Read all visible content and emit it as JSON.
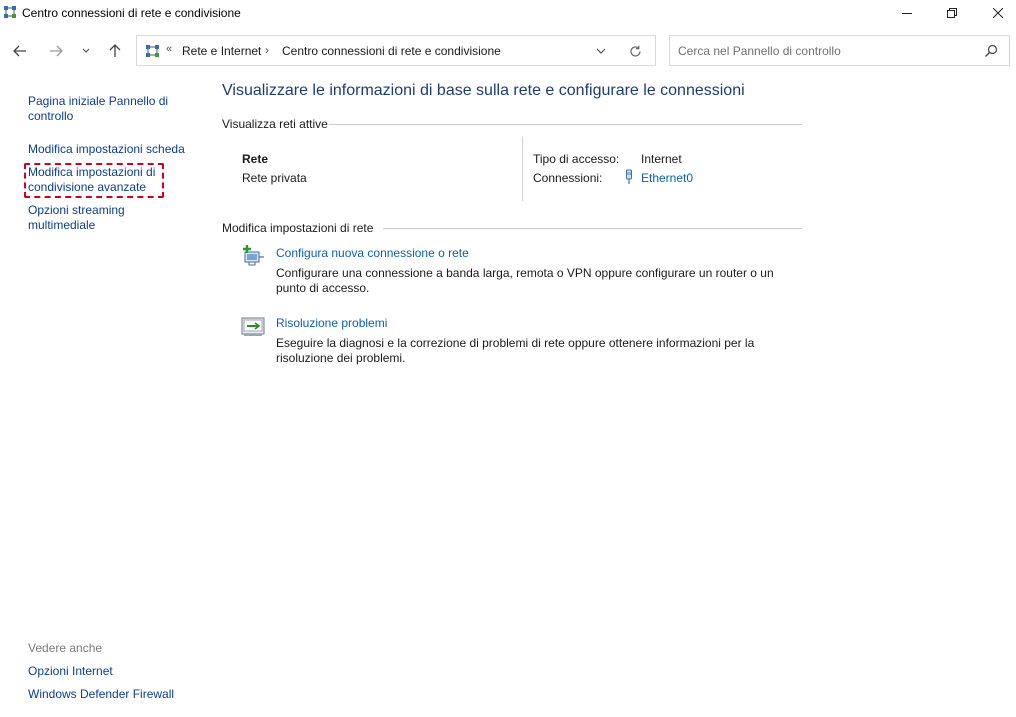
{
  "window": {
    "title": "Centro connessioni di rete e condivisione",
    "icon": "network-center-icon",
    "controls": [
      "minimize-icon",
      "restore-icon",
      "close-icon"
    ]
  },
  "nav": {
    "back_icon": "arrow-left-icon",
    "forward_icon": "arrow-right-icon",
    "recent_icon": "chevron-down-icon",
    "up_icon": "arrow-up-icon"
  },
  "address": {
    "overflow": "«",
    "crumbs": [
      "Rete e Internet",
      "Centro connessioni di rete e condivisione"
    ],
    "separator": "›"
  },
  "search": {
    "placeholder": "Cerca nel Pannello di controllo"
  },
  "sidebar": {
    "links": [
      "Pagina iniziale Pannello di controllo",
      "Modifica impostazioni scheda",
      "Modifica impostazioni di condivisione avanzate",
      "Opzioni streaming multimediale"
    ],
    "see_also_label": "Vedere anche",
    "see_also": [
      "Opzioni Internet",
      "Windows Defender Firewall"
    ]
  },
  "main": {
    "title": "Visualizzare le informazioni di base sulla rete e configurare le connessioni",
    "active_section": "Visualizza reti attive",
    "network": {
      "name": "Rete",
      "profile": "Rete privata",
      "access_label": "Tipo di accesso:",
      "access_value": "Internet",
      "connections_label": "Connessioni:",
      "connections_value": "Ethernet0"
    },
    "change_section": "Modifica impostazioni di rete",
    "tasks": [
      {
        "title": "Configura nuova connessione o rete",
        "description": "Configurare una connessione a banda larga, remota o VPN oppure configurare un router o un punto di accesso.",
        "icon": "new-connection-icon"
      },
      {
        "title": "Risoluzione problemi",
        "description": "Eseguire la diagnosi e la correzione di problemi di rete oppure ottenere informazioni per la risoluzione dei problemi.",
        "icon": "troubleshoot-icon"
      }
    ]
  },
  "colors": {
    "link": "#0b5fb3",
    "heading": "#1e3b78",
    "highlight": "#d0021b"
  }
}
